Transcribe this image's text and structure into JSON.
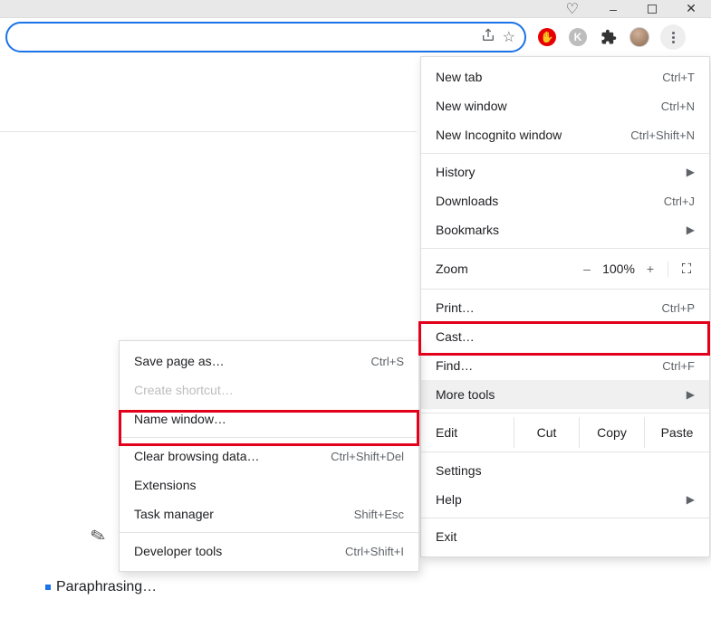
{
  "window_controls": {
    "min": "–",
    "max": "▢",
    "close": "✕"
  },
  "omnibox": {
    "placeholder": "",
    "value": ""
  },
  "menu": {
    "new_tab": {
      "label": "New tab",
      "shortcut": "Ctrl+T"
    },
    "new_window": {
      "label": "New window",
      "shortcut": "Ctrl+N"
    },
    "new_incognito": {
      "label": "New Incognito window",
      "shortcut": "Ctrl+Shift+N"
    },
    "history": {
      "label": "History"
    },
    "downloads": {
      "label": "Downloads",
      "shortcut": "Ctrl+J"
    },
    "bookmarks": {
      "label": "Bookmarks"
    },
    "zoom_label": "Zoom",
    "zoom_minus": "–",
    "zoom_value": "100%",
    "zoom_plus": "+",
    "print": {
      "label": "Print…",
      "shortcut": "Ctrl+P"
    },
    "cast": {
      "label": "Cast…"
    },
    "find": {
      "label": "Find…",
      "shortcut": "Ctrl+F"
    },
    "more_tools": {
      "label": "More tools"
    },
    "edit_label": "Edit",
    "cut": "Cut",
    "copy": "Copy",
    "paste": "Paste",
    "settings": {
      "label": "Settings"
    },
    "help": {
      "label": "Help"
    },
    "exit": {
      "label": "Exit"
    }
  },
  "submenu": {
    "save_page": {
      "label": "Save page as…",
      "shortcut": "Ctrl+S"
    },
    "create_shortcut": {
      "label": "Create shortcut…"
    },
    "name_window": {
      "label": "Name window…"
    },
    "clear_browsing": {
      "label": "Clear browsing data…",
      "shortcut": "Ctrl+Shift+Del"
    },
    "extensions": {
      "label": "Extensions"
    },
    "task_manager": {
      "label": "Task manager",
      "shortcut": "Shift+Esc"
    },
    "dev_tools": {
      "label": "Developer tools",
      "shortcut": "Ctrl+Shift+I"
    }
  },
  "page": {
    "status_text": "Paraphrasing…"
  },
  "icons": {
    "red_ext": "✋",
    "gray_ext": "K",
    "puzzle": "✦"
  }
}
